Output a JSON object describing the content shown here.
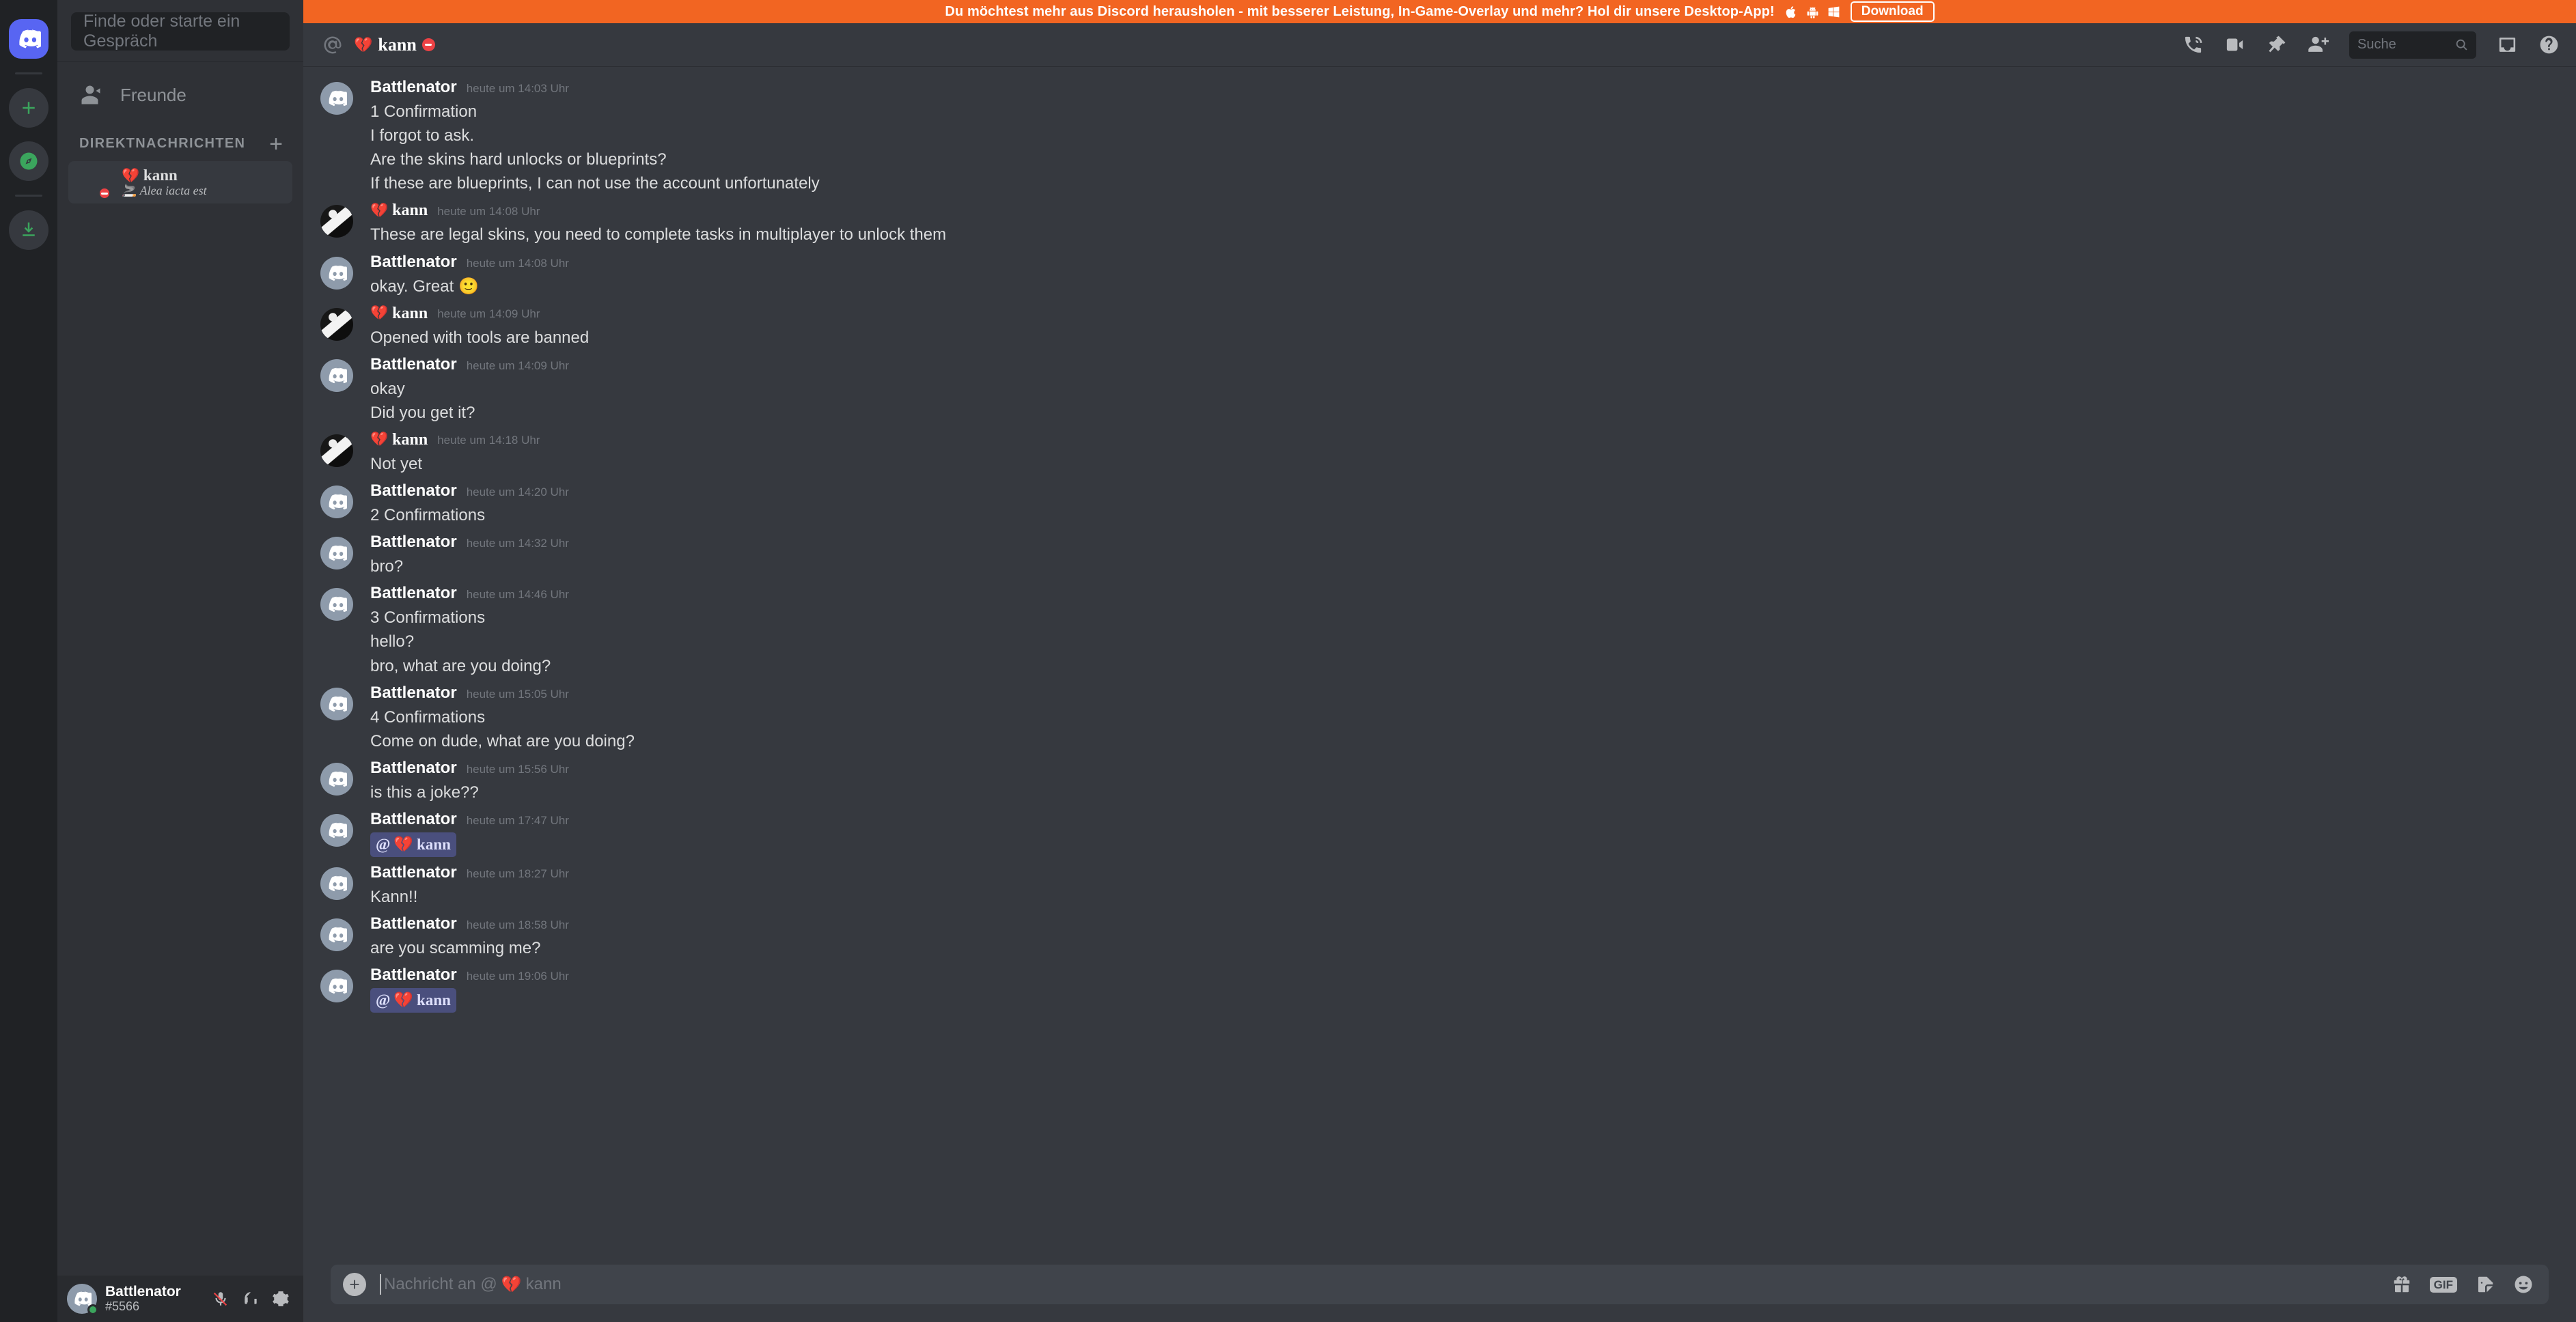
{
  "banner": {
    "text": "Du möchtest mehr aus Discord herausholen - mit besserer Leistung, In-Game-Overlay und mehr? Hol dir unsere Desktop-App!",
    "download_label": "Download",
    "bg_color": "#F26522",
    "os_icons": [
      "apple-icon",
      "android-icon",
      "windows-icon"
    ]
  },
  "rail": {
    "home_label": "discord-home",
    "items": [
      "add-server-icon",
      "explore-icon",
      "download-apps-icon"
    ]
  },
  "sidebar": {
    "search_placeholder": "Finde oder starte ein Gespräch",
    "friends_label": "Freunde",
    "section_label": "DIREKTNACHRICHTEN",
    "add_dm_label": "+",
    "dm": {
      "heart": "💔",
      "name": "kann",
      "status_emoji": "🚬",
      "status_text": "Alea iacta est",
      "presence": "dnd"
    }
  },
  "user_panel": {
    "name": "Battlenator",
    "tag": "#5566",
    "presence_color": "#3BA55D",
    "icons": [
      "microphone-muted-icon",
      "headphones-icon",
      "settings-gear-icon"
    ]
  },
  "header": {
    "at_icon": "at-icon",
    "heart": "💔",
    "title": "kann",
    "presence": "dnd",
    "search_placeholder": "Suche",
    "icons": [
      "call-icon",
      "video-icon",
      "pin-icon",
      "add-friend-icon",
      "inbox-icon",
      "help-icon"
    ]
  },
  "composer": {
    "placeholder_prefix": "Nachricht an @",
    "placeholder_heart": "💔",
    "placeholder_name": "kann",
    "gif_label": "GIF",
    "icons": [
      "gift-icon",
      "gif-icon",
      "sticker-icon",
      "emoji-icon"
    ]
  },
  "messages": [
    {
      "author": "Battlenator",
      "author_type": "bot",
      "time": "heute um 14:03 Uhr",
      "lines": [
        "1 Confirmation",
        "I forgot to ask.",
        "Are the skins hard unlocks or blueprints?",
        "If these are blueprints, I can not use the account unfortunately"
      ]
    },
    {
      "author": "kann",
      "author_type": "kann",
      "time": "heute um 14:08 Uhr",
      "lines": [
        "These are legal skins, you need to complete tasks in multiplayer to unlock them"
      ]
    },
    {
      "author": "Battlenator",
      "author_type": "bot",
      "time": "heute um 14:08 Uhr",
      "lines": [
        "okay. Great 🙂"
      ]
    },
    {
      "author": "kann",
      "author_type": "kann",
      "time": "heute um 14:09 Uhr",
      "lines": [
        "Opened with tools are banned"
      ]
    },
    {
      "author": "Battlenator",
      "author_type": "bot",
      "time": "heute um 14:09 Uhr",
      "lines": [
        "okay",
        "Did you get it?"
      ]
    },
    {
      "author": "kann",
      "author_type": "kann",
      "time": "heute um 14:18 Uhr",
      "lines": [
        "Not yet"
      ]
    },
    {
      "author": "Battlenator",
      "author_type": "bot",
      "time": "heute um 14:20 Uhr",
      "lines": [
        "2 Confirmations"
      ]
    },
    {
      "author": "Battlenator",
      "author_type": "bot",
      "time": "heute um 14:32 Uhr",
      "lines": [
        "bro?"
      ]
    },
    {
      "author": "Battlenator",
      "author_type": "bot",
      "time": "heute um 14:46 Uhr",
      "lines": [
        "3 Confirmations",
        "hello?",
        "bro, what are you doing?"
      ]
    },
    {
      "author": "Battlenator",
      "author_type": "bot",
      "time": "heute um 15:05 Uhr",
      "lines": [
        "4 Confirmations",
        "Come on dude, what are you doing?"
      ]
    },
    {
      "author": "Battlenator",
      "author_type": "bot",
      "time": "heute um 15:56 Uhr",
      "lines": [
        "is this a joke??"
      ]
    },
    {
      "author": "Battlenator",
      "author_type": "bot",
      "time": "heute um 17:47 Uhr",
      "mention": {
        "heart": "💔",
        "name": "kann"
      },
      "lines": []
    },
    {
      "author": "Battlenator",
      "author_type": "bot",
      "time": "heute um 18:27 Uhr",
      "lines": [
        "Kann!!"
      ]
    },
    {
      "author": "Battlenator",
      "author_type": "bot",
      "time": "heute um 18:58 Uhr",
      "lines": [
        "are you scamming me?"
      ]
    },
    {
      "author": "Battlenator",
      "author_type": "bot",
      "time": "heute um 19:06 Uhr",
      "mention": {
        "heart": "💔",
        "name": "kann"
      },
      "lines": []
    }
  ],
  "theme": {
    "rail_bg": "#202225",
    "sidebar_bg": "#2F3136",
    "chat_bg": "#36393F",
    "accent": "#5865F2",
    "online": "#3BA55D",
    "dnd": "#ED4245",
    "mention_bg": "#4a4f7d"
  }
}
